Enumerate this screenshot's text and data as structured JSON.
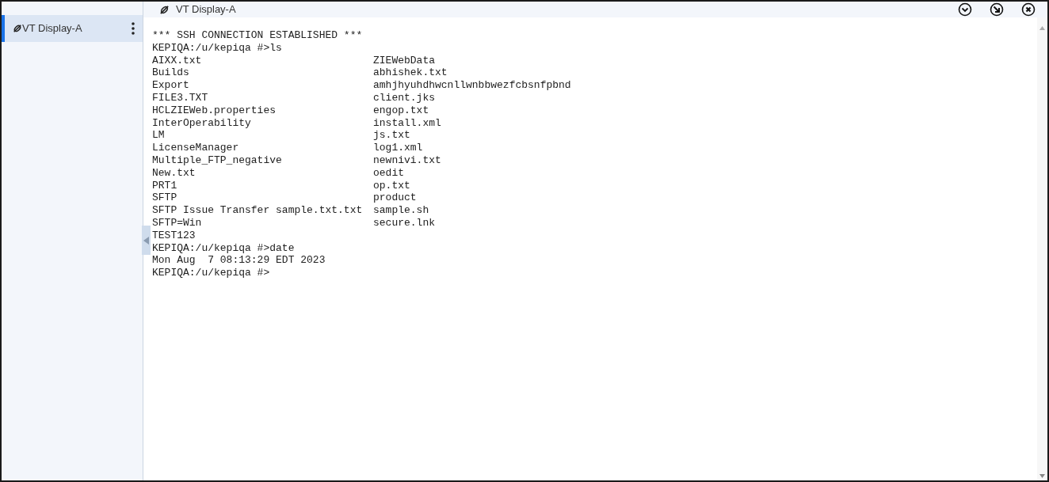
{
  "sidebar": {
    "items": [
      {
        "label": "VT Display-A",
        "selected": true
      }
    ]
  },
  "window": {
    "title": "VT Display-A"
  },
  "terminal": {
    "lines": [
      {
        "kind": "text",
        "text": "*** SSH CONNECTION ESTABLISHED ***"
      },
      {
        "kind": "text",
        "text": "KEPIQA:/u/kepiqa #>ls"
      },
      {
        "kind": "columns",
        "cells": [
          "AIXX.txt",
          "ZIEWebData"
        ]
      },
      {
        "kind": "columns",
        "cells": [
          "Builds",
          "abhishek.txt"
        ]
      },
      {
        "kind": "columns",
        "cells": [
          "Export",
          "amhjhyuhdhwcnllwnbbwezfcbsnfpbnd"
        ]
      },
      {
        "kind": "columns",
        "cells": [
          "FILE3.TXT",
          "client.jks"
        ]
      },
      {
        "kind": "columns",
        "cells": [
          "HCLZIEWeb.properties",
          "engop.txt"
        ]
      },
      {
        "kind": "columns",
        "cells": [
          "InterOperability",
          "install.xml"
        ]
      },
      {
        "kind": "columns",
        "cells": [
          "LM",
          "js.txt"
        ]
      },
      {
        "kind": "columns",
        "cells": [
          "LicenseManager",
          "log1.xml"
        ]
      },
      {
        "kind": "columns",
        "cells": [
          "Multiple_FTP_negative",
          "newnivi.txt"
        ]
      },
      {
        "kind": "columns",
        "cells": [
          "New.txt",
          "oedit"
        ]
      },
      {
        "kind": "columns",
        "cells": [
          "PRT1",
          "op.txt"
        ]
      },
      {
        "kind": "columns",
        "cells": [
          "SFTP",
          "product"
        ]
      },
      {
        "kind": "columns",
        "cells": [
          "SFTP Issue Transfer sample.txt.txt",
          "sample.sh"
        ]
      },
      {
        "kind": "columns",
        "cells": [
          "SFTP=Win",
          "secure.lnk"
        ]
      },
      {
        "kind": "text",
        "text": "TEST123"
      },
      {
        "kind": "text",
        "text": "KEPIQA:/u/kepiqa #>date"
      },
      {
        "kind": "text",
        "text": "Mon Aug  7 08:13:29 EDT 2023"
      },
      {
        "kind": "text",
        "text": "KEPIQA:/u/kepiqa #>"
      }
    ]
  }
}
